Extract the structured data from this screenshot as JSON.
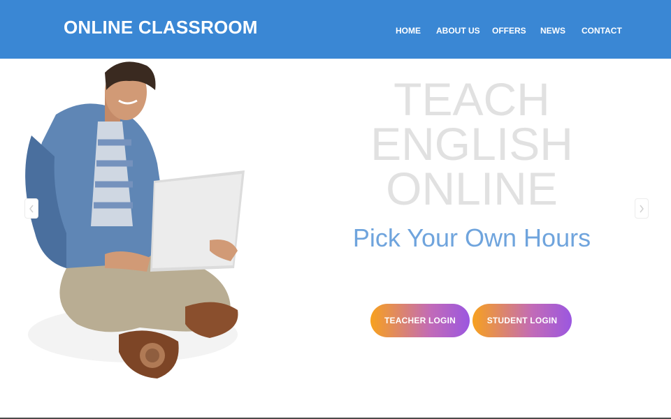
{
  "header": {
    "brand": "ONLINE CLASSROOM",
    "nav": {
      "home": "HOME",
      "about": "ABOUT US",
      "offers": "OFFERS",
      "news": "NEWS",
      "contact": "CONTACT"
    }
  },
  "hero": {
    "headline": [
      "TEACH",
      "ENGLISH",
      "ONLINE"
    ],
    "subheadline": "Pick Your Own Hours",
    "buttons": {
      "teacher": "TEACHER LOGIN",
      "student": "STUDENT LOGIN"
    },
    "carousel": {
      "prev_icon": "chevron-left-icon",
      "next_icon": "chevron-right-icon"
    }
  },
  "colors": {
    "topbar": "#3a87d4",
    "headline": "#e1e1e1",
    "subheadline": "#6fa4dd",
    "button_gradient_start": "#f7a11e",
    "button_gradient_end": "#9b57e0"
  }
}
